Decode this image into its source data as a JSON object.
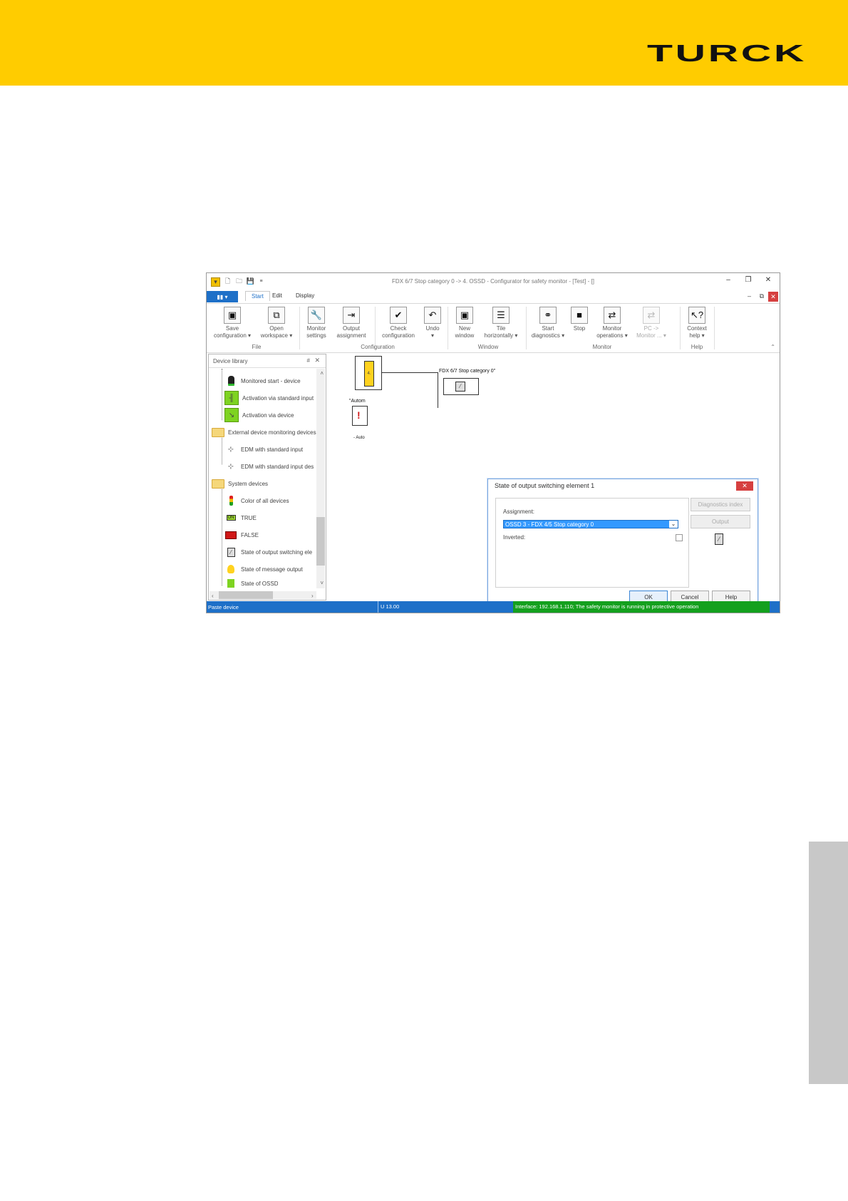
{
  "colors": {
    "brand_yellow": "#ffcc00",
    "accent_blue": "#1e70c8",
    "status_green": "#14a01e",
    "close_red": "#d64040"
  },
  "brand": {
    "logo_text": "TURCK"
  },
  "window": {
    "title": "FDX 6/7 Stop category 0 -> 4. OSSD - Configurator for safety monitor - [Test] - []",
    "controls": {
      "minimize": "–",
      "maximize": "❐",
      "close": "✕"
    }
  },
  "ribbon_tabs": {
    "file": "▮▮ ▾",
    "items": [
      "Start",
      "Edit",
      "Display"
    ],
    "active": "Start"
  },
  "ribbon": {
    "save": {
      "line1": "Save",
      "line2": "configuration ▾"
    },
    "open": {
      "line1": "Open",
      "line2": "workspace ▾"
    },
    "monitor_settings": {
      "line1": "Monitor",
      "line2": "settings"
    },
    "output_assignment": {
      "line1": "Output",
      "line2": "assignment"
    },
    "check_configuration": {
      "line1": "Check",
      "line2": "configuration"
    },
    "undo": {
      "line1": "Undo",
      "line2": "▾"
    },
    "new_window": {
      "line1": "New",
      "line2": "window"
    },
    "tile_horizontally": {
      "line1": "Tile",
      "line2": "horizontally ▾"
    },
    "start_diagnostics": {
      "line1": "Start",
      "line2": "diagnostics ▾"
    },
    "stop": {
      "line1": "Stop",
      "line2": ""
    },
    "monitor_operations": {
      "line1": "Monitor",
      "line2": "operations ▾"
    },
    "pc_monitor": {
      "line1": "PC ->",
      "line2": "Monitor ... ▾"
    },
    "context_help": {
      "line1": "Context",
      "line2": "help ▾"
    },
    "groups": {
      "file": "File",
      "configuration": "Configuration",
      "window": "Window",
      "monitor": "Monitor",
      "help": "Help"
    }
  },
  "device_library": {
    "title": "Device library",
    "pin": "#",
    "close": "✕",
    "items": [
      {
        "label": "Monitored start - device",
        "icon": "lamp-icon"
      },
      {
        "label": "Activation via standard input",
        "icon": "switch-icon"
      },
      {
        "label": "Activation via device",
        "icon": "switch-icon"
      },
      {
        "label": "External device monitoring devices",
        "icon": "folder-icon"
      },
      {
        "label": "EDM with standard input",
        "icon": "edm-icon"
      },
      {
        "label": "EDM with standard input des",
        "icon": "edm-icon"
      },
      {
        "label": "System devices",
        "icon": "folder-icon"
      },
      {
        "label": "Color of all devices",
        "icon": "traffic-light-icon"
      },
      {
        "label": "TRUE",
        "icon": "on-icon"
      },
      {
        "label": "FALSE",
        "icon": "off-icon"
      },
      {
        "label": "State of output switching ele",
        "icon": "relay-icon"
      },
      {
        "label": "State of message output",
        "icon": "bulb-icon"
      },
      {
        "label": "State of OSSD",
        "icon": "ossd-icon"
      }
    ],
    "on_text": "ON"
  },
  "canvas": {
    "block_value": "4.",
    "block_label": "FDX 6/7 Stop category 0\"",
    "auto_label": "\"Autom",
    "auto_sub": "- Auto"
  },
  "dialog": {
    "title": "State of output switching element 1",
    "close": "✕",
    "assignment_label": "Assignment:",
    "assignment_value": "OSSD 3 - FDX 4/5 Stop category 0",
    "inverted_label": "Inverted:",
    "diagnostics_index": "Diagnostics index",
    "output": "Output",
    "ok": "OK",
    "cancel": "Cancel",
    "help": "Help"
  },
  "status_bar": {
    "left": "Paste device",
    "version": "U 13.00",
    "interface": "Interface: 192.168.1.110; The safety monitor is running in protective operation"
  }
}
